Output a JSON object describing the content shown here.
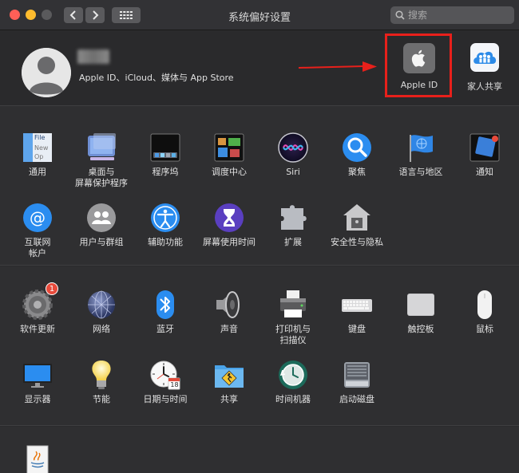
{
  "window": {
    "title": "系统偏好设置",
    "search_placeholder": "搜索"
  },
  "account": {
    "subtitle": "Apple ID、iCloud、媒体与 App Store",
    "apple_id_label": "Apple ID",
    "family_label": "家人共享"
  },
  "section1": {
    "row1": [
      {
        "label": "通用",
        "icon": "general-icon"
      },
      {
        "label": "桌面与\n屏幕保护程序",
        "icon": "desktop-icon"
      },
      {
        "label": "程序坞",
        "icon": "dock-icon"
      },
      {
        "label": "调度中心",
        "icon": "mission-control-icon"
      },
      {
        "label": "Siri",
        "icon": "siri-icon"
      },
      {
        "label": "聚焦",
        "icon": "spotlight-icon"
      },
      {
        "label": "语言与地区",
        "icon": "language-flag-icon"
      },
      {
        "label": "通知",
        "icon": "notifications-icon"
      }
    ],
    "row2": [
      {
        "label": "互联网\n帐户",
        "icon": "internet-accounts-icon"
      },
      {
        "label": "用户与群组",
        "icon": "users-icon"
      },
      {
        "label": "辅助功能",
        "icon": "accessibility-icon"
      },
      {
        "label": "屏幕使用时间",
        "icon": "screen-time-icon"
      },
      {
        "label": "扩展",
        "icon": "extensions-icon"
      },
      {
        "label": "安全性与隐私",
        "icon": "security-house-icon"
      }
    ],
    "general_icon_text": [
      "File",
      "New",
      "Op"
    ]
  },
  "section2": {
    "row1": [
      {
        "label": "软件更新",
        "icon": "software-update-gear-icon",
        "badge": "1"
      },
      {
        "label": "网络",
        "icon": "network-globe-icon"
      },
      {
        "label": "蓝牙",
        "icon": "bluetooth-icon"
      },
      {
        "label": "声音",
        "icon": "sound-speaker-icon"
      },
      {
        "label": "打印机与\n扫描仪",
        "icon": "printer-icon"
      },
      {
        "label": "键盘",
        "icon": "keyboard-icon"
      },
      {
        "label": "触控板",
        "icon": "trackpad-icon"
      },
      {
        "label": "鼠标",
        "icon": "mouse-icon"
      }
    ],
    "row2": [
      {
        "label": "显示器",
        "icon": "display-icon"
      },
      {
        "label": "节能",
        "icon": "energy-bulb-icon"
      },
      {
        "label": "日期与时间",
        "icon": "clock-calendar-icon"
      },
      {
        "label": "共享",
        "icon": "sharing-folder-icon"
      },
      {
        "label": "时间机器",
        "icon": "time-machine-icon"
      },
      {
        "label": "启动磁盘",
        "icon": "startup-disk-icon"
      }
    ],
    "calendar_day": "18"
  },
  "section3": {
    "items": [
      {
        "label": "",
        "icon": "java-icon"
      }
    ]
  },
  "colors": {
    "highlight_border": "#e8201b",
    "arrow": "#e8201b"
  }
}
